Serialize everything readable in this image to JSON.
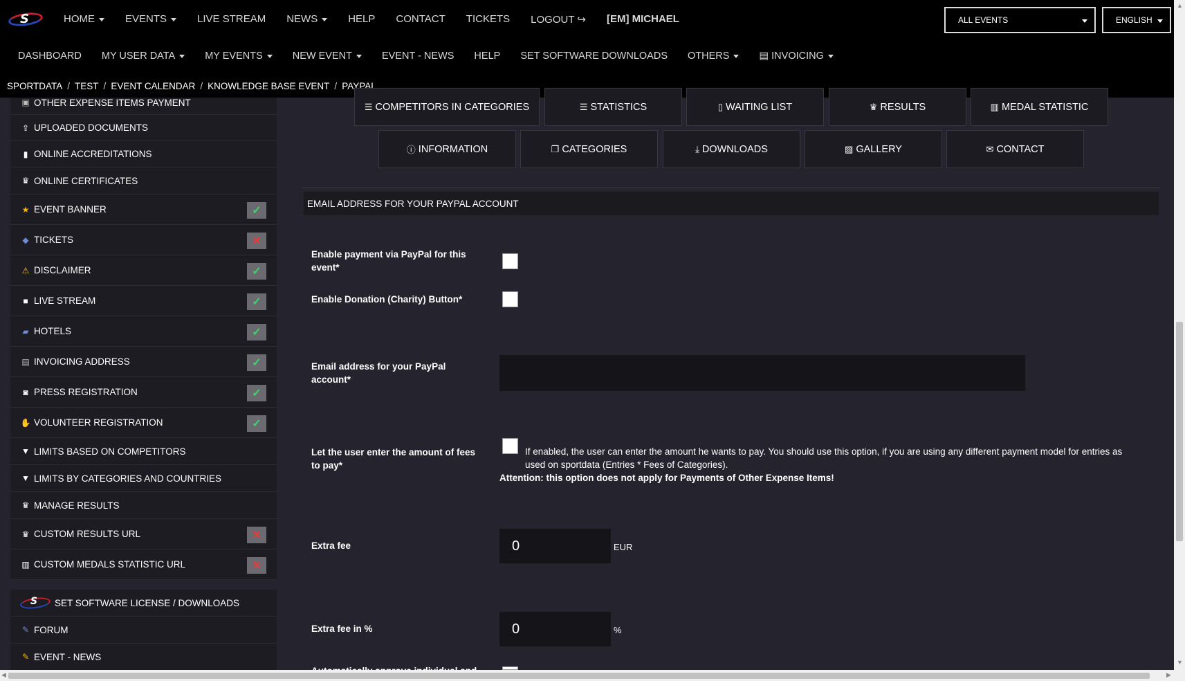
{
  "topnav": {
    "items": [
      "HOME",
      "EVENTS",
      "LIVE STREAM",
      "NEWS",
      "HELP",
      "CONTACT",
      "TICKETS",
      "LOGOUT",
      "[EM] MICHAEL"
    ],
    "event_select": "ALL EVENTS",
    "language_select": "ENGLISH"
  },
  "subnav": {
    "items": [
      "DASHBOARD",
      "MY USER DATA",
      "MY EVENTS",
      "NEW EVENT",
      "EVENT - NEWS",
      "HELP",
      "SET SOFTWARE DOWNLOADS",
      "OTHERS",
      "INVOICING"
    ]
  },
  "breadcrumb": [
    "SPORTDATA",
    "TEST",
    "EVENT CALENDAR",
    "KNOWLEDGE BASE EVENT",
    "PAYPAL"
  ],
  "sidebar": {
    "items": [
      {
        "label": "OTHER EXPENSE ITEMS PAYMENT",
        "icon": "payment-icon"
      },
      {
        "label": "UPLOADED DOCUMENTS",
        "icon": "upload-icon"
      },
      {
        "label": "ONLINE ACCREDITATIONS",
        "icon": "badge-icon"
      },
      {
        "label": "ONLINE CERTIFICATES",
        "icon": "trophy-icon"
      },
      {
        "label": "EVENT BANNER",
        "icon": "star-icon",
        "status": "ok"
      },
      {
        "label": "TICKETS",
        "icon": "ticket-icon",
        "status": "no"
      },
      {
        "label": "DISCLAIMER",
        "icon": "warning-icon",
        "status": "ok"
      },
      {
        "label": "LIVE STREAM",
        "icon": "video-icon",
        "status": "ok"
      },
      {
        "label": "HOTELS",
        "icon": "luggage-icon",
        "status": "ok"
      },
      {
        "label": "INVOICING ADDRESS",
        "icon": "document-icon",
        "status": "ok"
      },
      {
        "label": "PRESS REGISTRATION",
        "icon": "camera-icon",
        "status": "ok"
      },
      {
        "label": "VOLUNTEER REGISTRATION",
        "icon": "hand-icon",
        "status": "ok"
      },
      {
        "label": "LIMITS BASED ON COMPETITORS",
        "icon": "filter-icon"
      },
      {
        "label": "LIMITS BY CATEGORIES AND COUNTRIES",
        "icon": "filter-icon"
      },
      {
        "label": "MANAGE RESULTS",
        "icon": "trophy-icon"
      },
      {
        "label": "CUSTOM RESULTS URL",
        "icon": "trophy-icon",
        "status": "no"
      },
      {
        "label": "CUSTOM MEDALS STATISTIC URL",
        "icon": "bar-chart-icon",
        "status": "no"
      }
    ],
    "bottom_items": [
      {
        "label": "SET SOFTWARE LICENSE / DOWNLOADS",
        "icon": "sportdata-logo-icon"
      },
      {
        "label": "FORUM",
        "icon": "forum-icon"
      },
      {
        "label": "EVENT - NEWS",
        "icon": "news-icon"
      }
    ]
  },
  "tabs": {
    "row1": [
      {
        "label": "COMPETITORS IN CATEGORIES",
        "icon": "list-icon"
      },
      {
        "label": "STATISTICS",
        "icon": "list-icon"
      },
      {
        "label": "WAITING LIST",
        "icon": "clipboard-icon"
      },
      {
        "label": "RESULTS",
        "icon": "trophy-icon"
      },
      {
        "label": "MEDAL STATISTIC",
        "icon": "bar-chart-icon"
      }
    ],
    "row2": [
      {
        "label": "INFORMATION",
        "icon": "info-icon"
      },
      {
        "label": "CATEGORIES",
        "icon": "copy-icon"
      },
      {
        "label": "DOWNLOADS",
        "icon": "download-icon"
      },
      {
        "label": "GALLERY",
        "icon": "image-icon"
      },
      {
        "label": "CONTACT",
        "icon": "envelope-icon"
      }
    ]
  },
  "form": {
    "section_title": "EMAIL ADDRESS FOR YOUR PAYPAL ACCOUNT",
    "enable_paypal_label": "Enable payment via PayPal for this event*",
    "enable_paypal_checked": false,
    "enable_donation_label": "Enable Donation (Charity) Button*",
    "enable_donation_checked": false,
    "email_label": "Email address for your PayPal account*",
    "email_value": "",
    "user_amount_label": "Let the user enter the amount of fees to pay*",
    "user_amount_checked": false,
    "user_amount_desc": "If enabled, the user can enter the amount he wants to pay. You should use this option, if you are using any different payment model for entries as used on sportdata (Entries * Fees of Categories).",
    "user_amount_attention": "Attention: this option does not apply for Payments of Other Expense Items!",
    "extra_fee_label": "Extra fee",
    "extra_fee_value": "0",
    "extra_fee_unit": "EUR",
    "extra_fee_pct_label": "Extra fee in %",
    "extra_fee_pct_value": "0",
    "extra_fee_pct_unit": "%",
    "auto_approve_label": "Automatically approve individual and"
  }
}
